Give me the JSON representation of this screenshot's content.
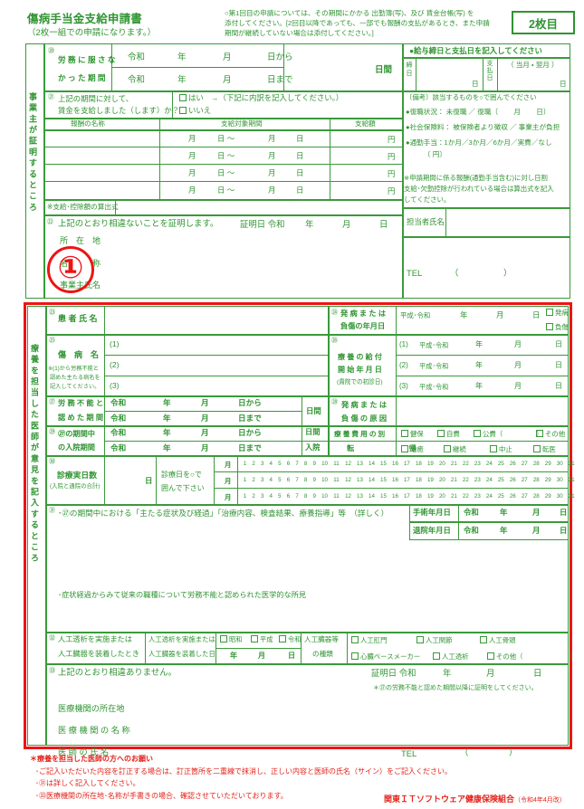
{
  "header": {
    "title": "傷病手当金支給申請書",
    "subtitle": "（2枚一組での申請になります。）",
    "note_line1": "○第1回目の申請については、その期間にかかる 出勤簿(写)、及び 賃金台帳(写) を",
    "note_line2": "添付してください。[2回目以降であっても、一部でも報酬の支払があるとき、また申請",
    "note_line3": "期間が継続していない場合は添付してください。]",
    "sheet_label": "2枚目"
  },
  "employer_section": {
    "vertical_label": "事業主が証明するところ",
    "annotation_number": "①",
    "row20": {
      "num": "⑳",
      "label_line1": "労 務 に 服 さ な",
      "label_line2": "か っ た 期 間",
      "era1": "令和",
      "y1": "年",
      "m1": "月",
      "d1": "日から",
      "era2": "令和",
      "y2": "年",
      "m2": "月",
      "d2": "日まで",
      "days": "日間"
    },
    "row21": {
      "num": "㉑",
      "label_line1": "上記の期間に対して、",
      "label_line2": "賃金を支給しました（します）か？",
      "opt_yes": "はい　→（下記に内訳を記入してください。）",
      "opt_no": "いいえ"
    },
    "wage_table": {
      "headers": [
        "報酬の名称",
        "支給対象期間",
        "支給額"
      ],
      "rows": [
        {
          "period": [
            "月",
            "日 ～",
            "月",
            "日"
          ],
          "unit": "円"
        },
        {
          "period": [
            "月",
            "日 ～",
            "月",
            "日"
          ],
          "unit": "円"
        },
        {
          "period": [
            "月",
            "日 ～",
            "月",
            "日"
          ],
          "unit": "円"
        },
        {
          "period": [
            "月",
            "日 ～",
            "月",
            "日"
          ],
          "unit": "円"
        }
      ]
    },
    "formula_label": "※支給･控除額の算出式",
    "row22": {
      "num": "㉒",
      "text": "上記のとおり相違ないことを証明します。",
      "cert_label": "証明日 令和",
      "y": "年",
      "m": "月",
      "d": "日",
      "f_address": "所　在　地",
      "f_name": "名　　　称",
      "f_rep": "事業主氏名"
    },
    "payroll": {
      "heading": "●給与締日と支払日を記入してください",
      "closing_label": "締日",
      "closing_unit": "日",
      "pay_label": "支払日",
      "pay_month_note": "（ 当月 ・ 翌月 ）",
      "pay_unit": "日",
      "remarks_heading": "〔備考〕該当するものを○で囲んでください",
      "item1": "●復職状況： 未復職 ／ 復職〔　　 月　　 日〕",
      "item2": "●社会保険料： 被保険者より徴収 ／ 事業主が負担",
      "item3_line1": "●通勤手当：1か月／3か月／6か月／実費／なし",
      "item3_line2": "〔                                    円〕",
      "note_line1": "※申請期間に係る報酬(通勤手当含む)に対し日割",
      "note_line2": "支給･欠勤控除が行われている場合は算出式を記入",
      "note_line3": "してください。",
      "staff_label": "担当者氏名",
      "tel_label": "TEL",
      "tel_paren_l": "（",
      "tel_paren_r": "）"
    }
  },
  "doctor_section": {
    "vertical_label": "療養を担当した医師が意見を記入するところ",
    "row23": {
      "num": "㉓",
      "label": "患 者 氏 名"
    },
    "row24": {
      "num": "㉔",
      "label_line1": "発 病 ま た は",
      "label_line2": "負傷の年月日",
      "era": "平成･令和",
      "y": "年",
      "m": "月",
      "d": "日",
      "opt1": "発病",
      "opt2": "負傷"
    },
    "row25": {
      "num": "㉕",
      "label": "傷　病　名",
      "note_line1": "※(1)から労務不能と",
      "note_line2": "認めた主たる病名を",
      "note_line3": "記入してください。",
      "items": [
        "(1)",
        "(2)",
        "(3)"
      ]
    },
    "row26": {
      "num": "㉖",
      "label_line1": "療 養 の 給 付",
      "label_line2": "開 始 年 月 日",
      "label_line3": "(貴院での初診日)",
      "rows": [
        {
          "idx": "(1)",
          "era": "平成･令和",
          "y": "年",
          "m": "月",
          "d": "日"
        },
        {
          "idx": "(2)",
          "era": "平成･令和",
          "y": "年",
          "m": "月",
          "d": "日"
        },
        {
          "idx": "(3)",
          "era": "平成･令和",
          "y": "年",
          "m": "月",
          "d": "日"
        }
      ]
    },
    "row27": {
      "num": "㉗",
      "label_line1": "労 務 不 能 と",
      "label_line2": "認 め た 期 間",
      "era1": "令和",
      "y1": "年",
      "m1": "月",
      "d1": "日から",
      "era2": "令和",
      "y2": "年",
      "m2": "月",
      "d2": "日まで",
      "days": "日間"
    },
    "row28": {
      "num": "㉘",
      "label_line1": "発 病 ま た は",
      "label_line2": "負 傷 の 原 因"
    },
    "row29": {
      "num": "㉙",
      "label_line1": "㉗の期間中",
      "label_line2": "の入院期間",
      "era1": "令和",
      "y1": "年",
      "m1": "月",
      "d1": "日から",
      "era2": "令和",
      "y2": "年",
      "m2": "月",
      "d2": "日まで",
      "days": "日間",
      "days2": "入院",
      "cost_label": "療 養 費 用 の 別",
      "cost_opts": [
        "健保",
        "自費",
        "公費（　　　　　）",
        "その他"
      ],
      "outcome_label": "転　　　帰",
      "outcome_opts": [
        "治癒",
        "継続",
        "中止",
        "転医"
      ]
    },
    "row30": {
      "num": "㉚",
      "label": "診療実日数",
      "sublabel": "(入院と通院の合計)",
      "unit": "日",
      "circle_note_line1": "診療日を○で",
      "circle_note_line2": "囲んで下さい",
      "month_label": "月",
      "days": [
        1,
        2,
        3,
        4,
        5,
        6,
        7,
        8,
        9,
        10,
        11,
        12,
        13,
        14,
        15,
        16,
        17,
        18,
        19,
        20,
        21,
        22,
        23,
        24,
        25,
        26,
        27,
        28,
        29,
        30,
        31
      ]
    },
    "row31": {
      "num": "㉛",
      "text": "･㉗の期間中における「主たる症状及び経過」「治療内容、検査結果、療養指導」等　（詳しく）",
      "text2": "･症状経過からみて従来の職種について労務不能と認められた医学的な所見",
      "surgery_label": "手術年月日",
      "surgery_era": "令和",
      "surgery_y": "年",
      "surgery_m": "月",
      "surgery_d": "日",
      "discharge_label": "退院年月日",
      "discharge_era": "令和",
      "discharge_y": "年",
      "discharge_m": "月",
      "discharge_d": "日"
    },
    "row32": {
      "num": "㉜",
      "label_line1": "人工透析を実施または",
      "label_line2": "人工臓器を装着したとき",
      "date_label_line1": "人工透析を実施または",
      "date_label_line2": "人工臓器を装着した日",
      "eras": [
        "昭和",
        "平成",
        "令和"
      ],
      "y": "年",
      "m": "月",
      "d": "日",
      "kind_label_line1": "人工臓器等",
      "kind_label_line2": "の種類",
      "kinds_row1": [
        "人工肛門",
        "人工関節",
        "人工骨頭"
      ],
      "kinds_row2": [
        "心臓ペースメーカー",
        "人工透析",
        "その他（　　　　　　　）"
      ]
    },
    "row33": {
      "num": "㉝",
      "text": "上記のとおり相違ありません。",
      "cert_label": "証明日 令和",
      "y": "年",
      "m": "月",
      "d": "日",
      "cert_note": "＊㉗の労務不能と認めた期間以降に証明をしてください。",
      "f_address": "医療機関の所在地",
      "f_name": "医 療 機 関 の 名 称",
      "f_doctor": "医 師 の 氏 名",
      "tel_label": "TEL",
      "tel_paren_l": "（",
      "tel_paren_r": "）"
    }
  },
  "footer": {
    "heading": "＊療養を担当した医師の方へのお願い",
    "line1": "･ご記入いただいた内容を訂正する場合は、訂正箇所を二重線で抹消し、正しい内容と医師の氏名（サイン）をご記入ください。",
    "line2": "･㉛は詳しく記入してください。",
    "line3": "･㉝医療機関の所在地･名称が手書きの場合、確認させていただいております。",
    "org": "関東ＩＴソフトウェア健康保険組合",
    "org_rev": "（令和4年4月改）"
  },
  "colors": {
    "green": "#2f9431",
    "border_green": "#3a9a3a",
    "red": "#ee1414",
    "footer_red": "#e2231a"
  }
}
